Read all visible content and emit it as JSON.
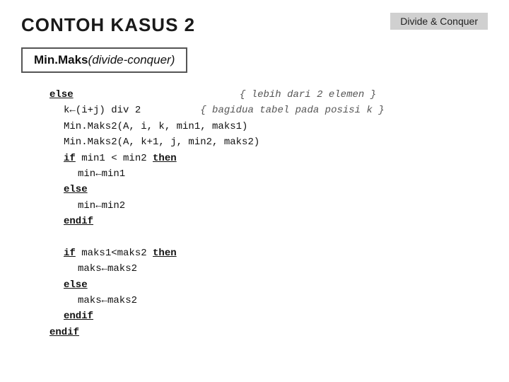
{
  "header": {
    "title": "CONTOH KASUS 2",
    "badge": "Divide & Conquer"
  },
  "subtitle": {
    "bold_part": "Min.Maks",
    "italic_part": "(divide-conquer)"
  },
  "code": {
    "lines": [
      {
        "indent": 0,
        "keyword": "else",
        "comment": "{ lebih dari 2 elemen }"
      },
      {
        "indent": 1,
        "text": "k←(i+j) div 2",
        "comment": "{ bagidua tabel pada posisi k }"
      },
      {
        "indent": 1,
        "text": "Min.Maks2(A, i, k, min1, maks1)"
      },
      {
        "indent": 1,
        "text": "Min.Maks2(A, k+1, j, min2, maks2)"
      },
      {
        "indent": 1,
        "keyword_start": "if",
        "text": " min1 < min2 ",
        "keyword_end": "then"
      },
      {
        "indent": 2,
        "text": "min←min1"
      },
      {
        "indent": 1,
        "keyword": "else"
      },
      {
        "indent": 2,
        "text": "min←min2"
      },
      {
        "indent": 1,
        "keyword": "endif"
      },
      {
        "indent": 0,
        "text": ""
      },
      {
        "indent": 1,
        "keyword_start": "if",
        "text": " maks1<maks2 ",
        "keyword_end": "then"
      },
      {
        "indent": 2,
        "text": "maks←maks2"
      },
      {
        "indent": 1,
        "keyword": "else"
      },
      {
        "indent": 2,
        "text": "maks←maks2"
      },
      {
        "indent": 1,
        "keyword": "endif"
      },
      {
        "indent": 0,
        "keyword": "endif"
      }
    ]
  }
}
